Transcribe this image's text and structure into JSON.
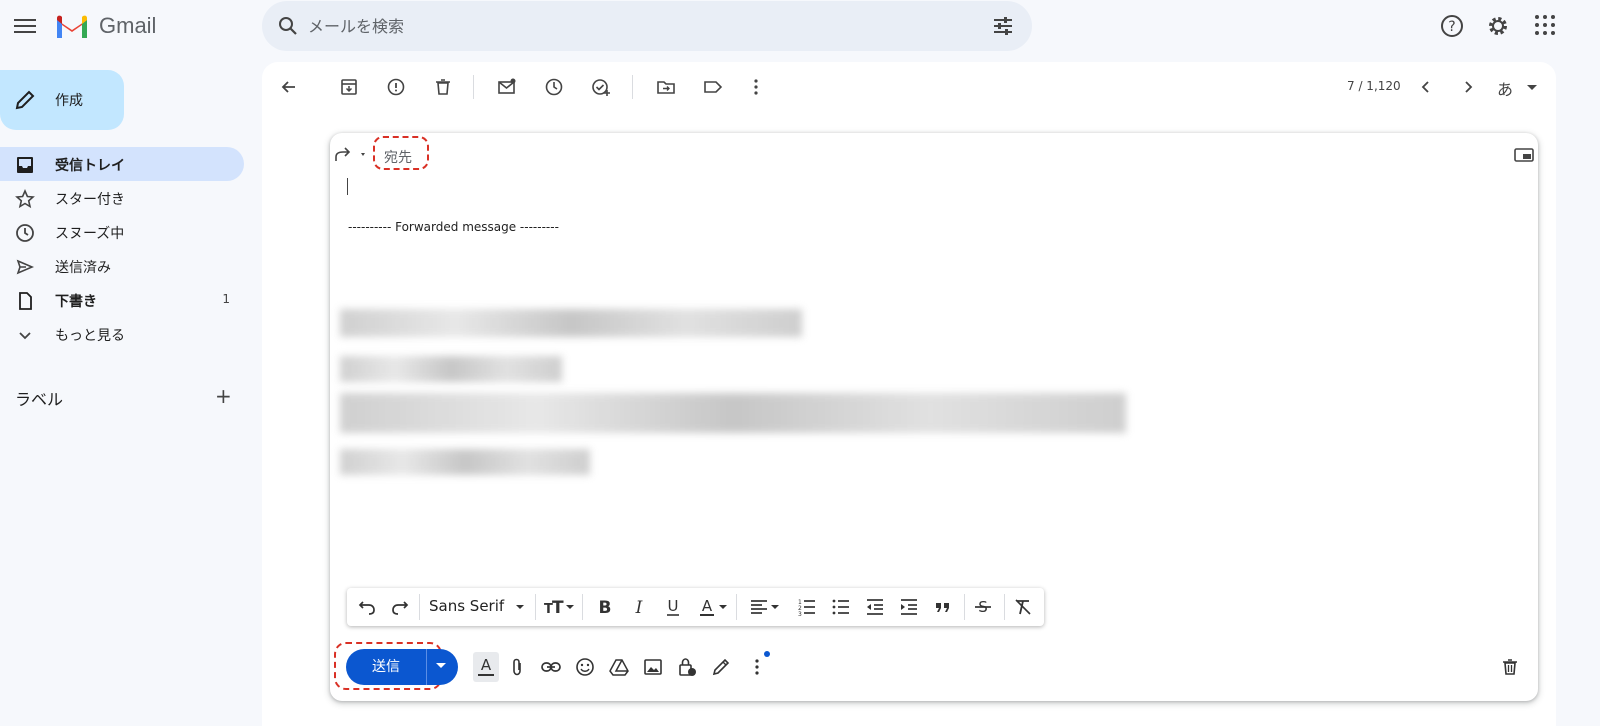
{
  "app": {
    "brand": "Gmail"
  },
  "search": {
    "placeholder": "メールを検索"
  },
  "sidebar": {
    "compose_label": "作成",
    "items": [
      {
        "label": "受信トレイ",
        "icon": "inbox-icon",
        "active": true,
        "count": ""
      },
      {
        "label": "スター付き",
        "icon": "star-icon",
        "active": false,
        "count": ""
      },
      {
        "label": "スヌーズ中",
        "icon": "clock-icon",
        "active": false,
        "count": ""
      },
      {
        "label": "送信済み",
        "icon": "send-icon",
        "active": false,
        "count": ""
      },
      {
        "label": "下書き",
        "icon": "draft-icon",
        "active": false,
        "count": "1"
      },
      {
        "label": "もっと見る",
        "icon": "chevron-down-icon",
        "active": false,
        "count": ""
      }
    ],
    "labels_title": "ラベル",
    "labels_add": "+"
  },
  "toolbar": {
    "pager": "7 / 1,120",
    "input_lang": "あ"
  },
  "compose": {
    "to_label": "宛先",
    "forwarded_header": "---------- Forwarded message ---------",
    "font_name": "Sans Serif",
    "send_label": "送信"
  },
  "colors": {
    "accent": "#0b57d0",
    "compose_bg": "#c2e7ff",
    "active_nav": "#d3e3fd",
    "annotation": "#d93025"
  }
}
